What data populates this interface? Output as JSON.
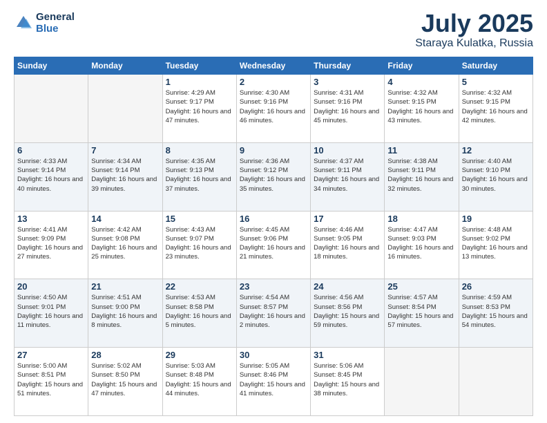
{
  "logo": {
    "line1": "General",
    "line2": "Blue"
  },
  "title": "July 2025",
  "subtitle": "Staraya Kulatka, Russia",
  "days_header": [
    "Sunday",
    "Monday",
    "Tuesday",
    "Wednesday",
    "Thursday",
    "Friday",
    "Saturday"
  ],
  "weeks": [
    [
      {
        "num": "",
        "info": ""
      },
      {
        "num": "",
        "info": ""
      },
      {
        "num": "1",
        "info": "Sunrise: 4:29 AM\nSunset: 9:17 PM\nDaylight: 16 hours\nand 47 minutes."
      },
      {
        "num": "2",
        "info": "Sunrise: 4:30 AM\nSunset: 9:16 PM\nDaylight: 16 hours\nand 46 minutes."
      },
      {
        "num": "3",
        "info": "Sunrise: 4:31 AM\nSunset: 9:16 PM\nDaylight: 16 hours\nand 45 minutes."
      },
      {
        "num": "4",
        "info": "Sunrise: 4:32 AM\nSunset: 9:15 PM\nDaylight: 16 hours\nand 43 minutes."
      },
      {
        "num": "5",
        "info": "Sunrise: 4:32 AM\nSunset: 9:15 PM\nDaylight: 16 hours\nand 42 minutes."
      }
    ],
    [
      {
        "num": "6",
        "info": "Sunrise: 4:33 AM\nSunset: 9:14 PM\nDaylight: 16 hours\nand 40 minutes."
      },
      {
        "num": "7",
        "info": "Sunrise: 4:34 AM\nSunset: 9:14 PM\nDaylight: 16 hours\nand 39 minutes."
      },
      {
        "num": "8",
        "info": "Sunrise: 4:35 AM\nSunset: 9:13 PM\nDaylight: 16 hours\nand 37 minutes."
      },
      {
        "num": "9",
        "info": "Sunrise: 4:36 AM\nSunset: 9:12 PM\nDaylight: 16 hours\nand 35 minutes."
      },
      {
        "num": "10",
        "info": "Sunrise: 4:37 AM\nSunset: 9:11 PM\nDaylight: 16 hours\nand 34 minutes."
      },
      {
        "num": "11",
        "info": "Sunrise: 4:38 AM\nSunset: 9:11 PM\nDaylight: 16 hours\nand 32 minutes."
      },
      {
        "num": "12",
        "info": "Sunrise: 4:40 AM\nSunset: 9:10 PM\nDaylight: 16 hours\nand 30 minutes."
      }
    ],
    [
      {
        "num": "13",
        "info": "Sunrise: 4:41 AM\nSunset: 9:09 PM\nDaylight: 16 hours\nand 27 minutes."
      },
      {
        "num": "14",
        "info": "Sunrise: 4:42 AM\nSunset: 9:08 PM\nDaylight: 16 hours\nand 25 minutes."
      },
      {
        "num": "15",
        "info": "Sunrise: 4:43 AM\nSunset: 9:07 PM\nDaylight: 16 hours\nand 23 minutes."
      },
      {
        "num": "16",
        "info": "Sunrise: 4:45 AM\nSunset: 9:06 PM\nDaylight: 16 hours\nand 21 minutes."
      },
      {
        "num": "17",
        "info": "Sunrise: 4:46 AM\nSunset: 9:05 PM\nDaylight: 16 hours\nand 18 minutes."
      },
      {
        "num": "18",
        "info": "Sunrise: 4:47 AM\nSunset: 9:03 PM\nDaylight: 16 hours\nand 16 minutes."
      },
      {
        "num": "19",
        "info": "Sunrise: 4:48 AM\nSunset: 9:02 PM\nDaylight: 16 hours\nand 13 minutes."
      }
    ],
    [
      {
        "num": "20",
        "info": "Sunrise: 4:50 AM\nSunset: 9:01 PM\nDaylight: 16 hours\nand 11 minutes."
      },
      {
        "num": "21",
        "info": "Sunrise: 4:51 AM\nSunset: 9:00 PM\nDaylight: 16 hours\nand 8 minutes."
      },
      {
        "num": "22",
        "info": "Sunrise: 4:53 AM\nSunset: 8:58 PM\nDaylight: 16 hours\nand 5 minutes."
      },
      {
        "num": "23",
        "info": "Sunrise: 4:54 AM\nSunset: 8:57 PM\nDaylight: 16 hours\nand 2 minutes."
      },
      {
        "num": "24",
        "info": "Sunrise: 4:56 AM\nSunset: 8:56 PM\nDaylight: 15 hours\nand 59 minutes."
      },
      {
        "num": "25",
        "info": "Sunrise: 4:57 AM\nSunset: 8:54 PM\nDaylight: 15 hours\nand 57 minutes."
      },
      {
        "num": "26",
        "info": "Sunrise: 4:59 AM\nSunset: 8:53 PM\nDaylight: 15 hours\nand 54 minutes."
      }
    ],
    [
      {
        "num": "27",
        "info": "Sunrise: 5:00 AM\nSunset: 8:51 PM\nDaylight: 15 hours\nand 51 minutes."
      },
      {
        "num": "28",
        "info": "Sunrise: 5:02 AM\nSunset: 8:50 PM\nDaylight: 15 hours\nand 47 minutes."
      },
      {
        "num": "29",
        "info": "Sunrise: 5:03 AM\nSunset: 8:48 PM\nDaylight: 15 hours\nand 44 minutes."
      },
      {
        "num": "30",
        "info": "Sunrise: 5:05 AM\nSunset: 8:46 PM\nDaylight: 15 hours\nand 41 minutes."
      },
      {
        "num": "31",
        "info": "Sunrise: 5:06 AM\nSunset: 8:45 PM\nDaylight: 15 hours\nand 38 minutes."
      },
      {
        "num": "",
        "info": ""
      },
      {
        "num": "",
        "info": ""
      }
    ]
  ]
}
